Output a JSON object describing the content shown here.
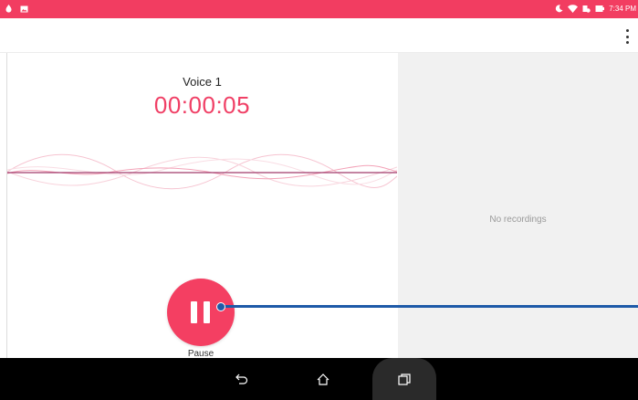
{
  "status_bar": {
    "time": "7:34 PM",
    "left_icons": [
      "notification-icon",
      "image-icon"
    ],
    "right_icons": [
      "moon-icon",
      "wifi-icon",
      "battery-saver-icon",
      "battery-icon"
    ],
    "color": "#f23d61"
  },
  "app_bar": {
    "menu_icon": "more-vert-icon"
  },
  "recorder": {
    "title": "Voice 1",
    "timer": "00:00:05",
    "accent_color": "#f04066"
  },
  "controls": {
    "pause_label": "Pause"
  },
  "recordings_list": {
    "empty_text": "No recordings"
  },
  "nav_bar": {
    "buttons": [
      "back-icon",
      "home-icon",
      "recents-icon"
    ]
  }
}
